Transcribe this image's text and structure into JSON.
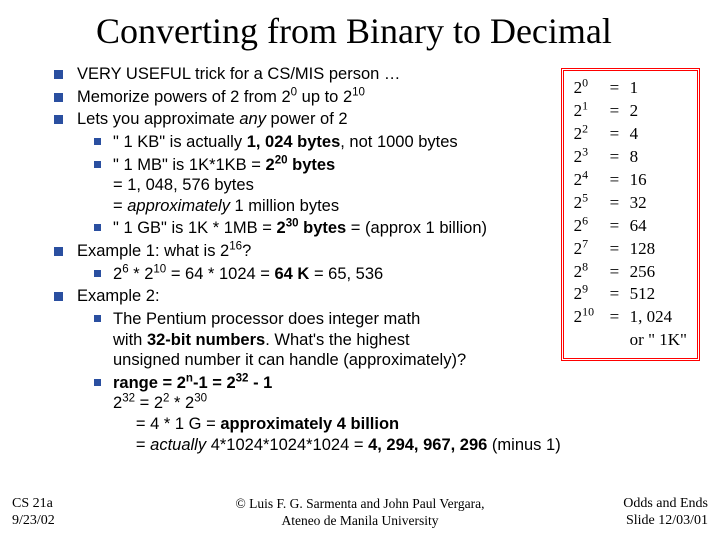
{
  "title": "Converting from Binary to Decimal",
  "bullets": {
    "b1": "VERY USEFUL trick for a CS/MIS person …",
    "b2_pre": "Memorize powers of 2 from 2",
    "b2_sup1": "0",
    "b2_mid": " up to 2",
    "b2_sup2": "10",
    "b3_pre": "Lets you approximate ",
    "b3_em": "any",
    "b3_post": " power of 2",
    "s1_a": "\" 1 KB\" is actually ",
    "s1_b": "1, 024 bytes",
    "s1_c": ", not 1000 bytes",
    "s2_a": "\" 1 MB\" is 1K*1KB = ",
    "s2_b": "2",
    "s2_sup": "20",
    "s2_c": " bytes",
    "s2_l2": "= 1, 048, 576 bytes",
    "s2_l3a": "= ",
    "s2_l3em": "approximately",
    "s2_l3b": "  1 million bytes",
    "s3_a": "\" 1 GB\" is 1K * 1MB = ",
    "s3_b": "2",
    "s3_sup": "30",
    "s3_c": " bytes",
    "s3_d": " = (approx 1 billion)",
    "b4_pre": "Example 1: what is 2",
    "b4_sup": "16",
    "b4_post": "?",
    "s4_a": "2",
    "s4_sup1": "6",
    "s4_b": " * 2",
    "s4_sup2": "10",
    "s4_c": " = 64 * 1024 = ",
    "s4_d": "64 K",
    "s4_e": " = 65, 536",
    "b5": "Example 2:",
    "s5_l1": "The Pentium processor does integer math",
    "s5_l2a": "with ",
    "s5_l2b": "32-bit numbers",
    "s5_l2c": ".  What's the highest",
    "s5_l3": "unsigned number it can handle (approximately)?",
    "s6_a": "range = 2",
    "s6_sup1": "n",
    "s6_b": "-1 = 2",
    "s6_sup2": "32",
    "s6_c": "  -  1",
    "s6_l2a": "2",
    "s6_l2s1": "32",
    "s6_l2b": "  =  2",
    "s6_l2s2": "2",
    "s6_l2c": " * 2",
    "s6_l2s3": "30",
    "s6_l3a": "= 4 * 1 G = ",
    "s6_l3b": "approximately 4 billion",
    "s6_l4a": "= ",
    "s6_l4em": "actually",
    "s6_l4b": " 4*1024*1024*1024  = ",
    "s6_l4c": "4, 294, 967, 296",
    "s6_l4d": " (minus 1)"
  },
  "powers": [
    {
      "p": "0",
      "v": "1"
    },
    {
      "p": "1",
      "v": "2"
    },
    {
      "p": "2",
      "v": "4"
    },
    {
      "p": "3",
      "v": "8"
    },
    {
      "p": "4",
      "v": "16"
    },
    {
      "p": "5",
      "v": "32"
    },
    {
      "p": "6",
      "v": "64"
    },
    {
      "p": "7",
      "v": "128"
    },
    {
      "p": "8",
      "v": "256"
    },
    {
      "p": "9",
      "v": "512"
    },
    {
      "p": "10",
      "v": "1, 024"
    }
  ],
  "powers_or": "or \" 1K\"",
  "footer": {
    "left1": "CS 21a",
    "left2": "9/23/02",
    "center1": "© Luis F. G. Sarmenta and John Paul Vergara,",
    "center2": "Ateneo de Manila University",
    "right1": "Odds and Ends",
    "right2": "Slide 12/03/01"
  }
}
